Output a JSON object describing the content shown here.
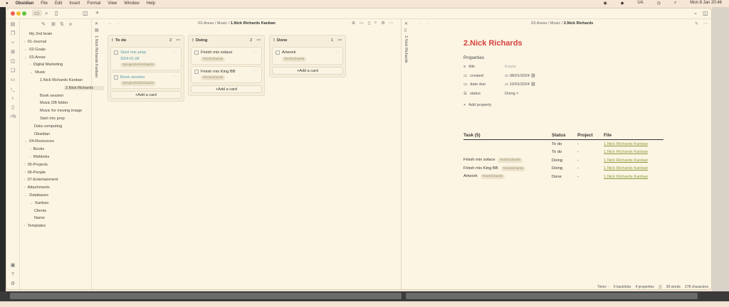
{
  "menubar": {
    "app": "Obsidian",
    "items": [
      "File",
      "Edit",
      "Insert",
      "Format",
      "View",
      "Window",
      "Help"
    ],
    "lang": "UA",
    "clock": "Mon 8 Jan 20:46"
  },
  "sidebar": {
    "vault": "My 2nd brain",
    "tree": [
      {
        "label": "01-Journal",
        "depth": 0,
        "chev": "›"
      },
      {
        "label": "02-Goals",
        "depth": 0,
        "chev": "⌄"
      },
      {
        "label": "03-Areas",
        "depth": 0,
        "chev": "⌄"
      },
      {
        "label": "Digital Marketing",
        "depth": 1,
        "chev": "›"
      },
      {
        "label": "Music",
        "depth": 1,
        "chev": "⌄"
      },
      {
        "label": "1.Nick Richards Kanban",
        "depth": 2,
        "chev": ""
      },
      {
        "label": "2.Nick Richards",
        "depth": 2,
        "chev": "",
        "selected": true
      },
      {
        "label": "Book session",
        "depth": 2,
        "chev": ""
      },
      {
        "label": "Music DB folder",
        "depth": 2,
        "chev": ""
      },
      {
        "label": "Music for moving image",
        "depth": 2,
        "chev": ""
      },
      {
        "label": "Start mix prep",
        "depth": 2,
        "chev": ""
      },
      {
        "label": "Data computing",
        "depth": 1,
        "chev": ""
      },
      {
        "label": "Obsidian",
        "depth": 1,
        "chev": ""
      },
      {
        "label": "04-Resources",
        "depth": 0,
        "chev": "⌄"
      },
      {
        "label": "Books",
        "depth": 1,
        "chev": "›"
      },
      {
        "label": "Weblinks",
        "depth": 1,
        "chev": "›"
      },
      {
        "label": "05-Projects",
        "depth": 0,
        "chev": "›"
      },
      {
        "label": "06-People",
        "depth": 0,
        "chev": "›"
      },
      {
        "label": "07-Entertainment",
        "depth": 0,
        "chev": "›"
      },
      {
        "label": "Attachments",
        "depth": 0,
        "chev": "›"
      },
      {
        "label": "Databases",
        "depth": 0,
        "chev": "⌄"
      },
      {
        "label": "Kanban",
        "depth": 1,
        "chev": "⌄"
      },
      {
        "label": "Clients",
        "depth": 1,
        "chev": ""
      },
      {
        "label": "Name",
        "depth": 1,
        "chev": ""
      },
      {
        "label": "Templates",
        "depth": 0,
        "chev": "›"
      }
    ]
  },
  "kanban": {
    "vtab": "1.Nick Richards Kanban",
    "breadcrumb": {
      "a": "03-Areas",
      "b": "Music",
      "current": "1.Nick Richards Kanban"
    },
    "add_card": "+Add a card",
    "columns": [
      {
        "title": "To do",
        "count": "2",
        "cards": [
          {
            "title": "Start mix prep",
            "date": "2024-01-08",
            "tag": "#project/nickrichards",
            "link": true
          },
          {
            "title": "Book session",
            "tag": "#project/nickrichards",
            "link": true
          }
        ]
      },
      {
        "title": "Doing",
        "count": "2",
        "cards": [
          {
            "title": "Finish mix solace",
            "tag": "#nickrichards"
          },
          {
            "title": "Finish mix King BB",
            "tag": "#nickrichards"
          }
        ]
      },
      {
        "title": "Done",
        "count": "1",
        "cards": [
          {
            "title": "Artwork",
            "tag": "#nickrichards"
          }
        ]
      }
    ]
  },
  "note": {
    "vtab": "2.Nick Richards",
    "breadcrumb": {
      "a": "03-Areas",
      "b": "Music",
      "current": "2.Nick Richards"
    },
    "title": "2.Nick Richards",
    "properties_label": "Properties",
    "properties": [
      {
        "key": "title",
        "value": "Empty"
      },
      {
        "key": "created",
        "value": "08/01/2024"
      },
      {
        "key": "date due",
        "value": "10/01/2024"
      },
      {
        "key": "status",
        "value": "Doing ×"
      }
    ],
    "add_property": "Add property",
    "table": {
      "headers": [
        "Task (5)",
        "Status",
        "Project",
        "File"
      ],
      "rows": [
        {
          "task": "",
          "tag": "",
          "status": "To do",
          "project": "-",
          "file": "1.Nick Richards Kanban"
        },
        {
          "task": "",
          "tag": "",
          "status": "To do",
          "project": "-",
          "file": "1.Nick Richards Kanban"
        },
        {
          "task": "Finish mix solace",
          "tag": "#nickrichards",
          "status": "Doing",
          "project": "-",
          "file": "1.Nick Richards Kanban"
        },
        {
          "task": "Finish mix King BB",
          "tag": "#nickrichards",
          "status": "Doing",
          "project": "-",
          "file": "1.Nick Richards Kanban"
        },
        {
          "task": "Artwork",
          "tag": "#nickrichards",
          "status": "Done",
          "project": "-",
          "file": "1.Nick Richards Kanban"
        }
      ]
    }
  },
  "statusbar": {
    "timer": "Timer: -",
    "backlinks": "0 backlinks",
    "properties": "4 properties",
    "words": "39 words",
    "chars": "278 characters"
  },
  "colors": {
    "accent_title": "#d6403f",
    "link": "#4f9aa8",
    "file_link": "#8a9a3a",
    "background": "#fcf5e4"
  }
}
